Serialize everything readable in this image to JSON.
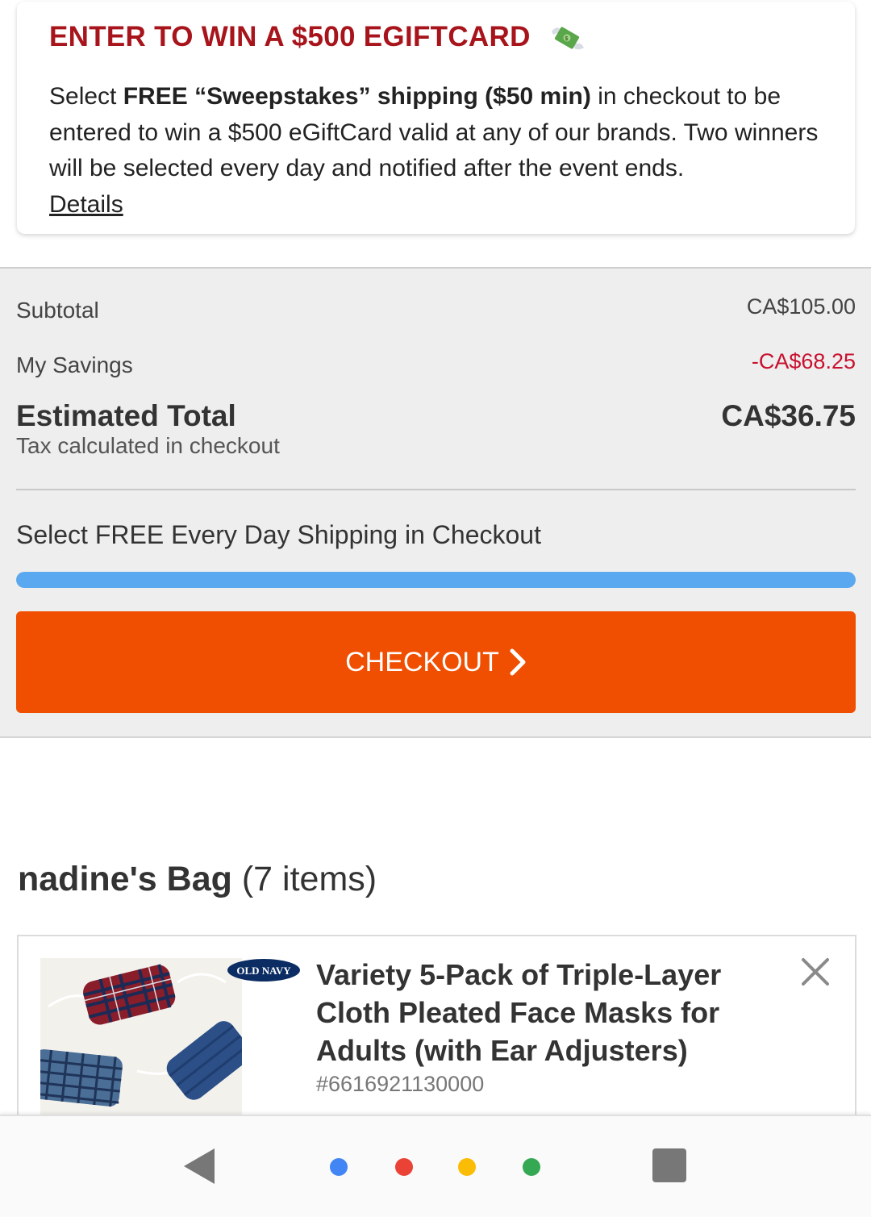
{
  "promo": {
    "title": "ENTER TO WIN A $500 EGIFTCARD",
    "icon": "money-with-wings-icon",
    "body_prefix": "Select ",
    "body_bold": "FREE “Sweepstakes” shipping ($50 min)",
    "body_rest": " in checkout to be entered to win a $500 eGiftCard valid at any of our brands. Two winners will be selected every day and notified after the event ends.",
    "details_link": "Details"
  },
  "summary": {
    "subtotal_label": "Subtotal",
    "subtotal_value": "CA$105.00",
    "savings_label": "My Savings",
    "savings_value": "-CA$68.25",
    "estimated_label": "Estimated Total",
    "estimated_value": "CA$36.75",
    "tax_note": "Tax calculated in checkout",
    "shipping_message": "Select FREE Every Day Shipping in Checkout",
    "shipping_progress_percent": 100,
    "checkout_label": "CHECKOUT"
  },
  "bag": {
    "owner": "nadine's Bag",
    "count": "(7 items)",
    "items": [
      {
        "brand": "OLD NAVY",
        "title": "Variety 5-Pack of Triple-Layer Cloth Pleated Face Masks for Adults (with Ear Adjusters)",
        "sku": "#6616921130000"
      }
    ]
  },
  "colors": {
    "promo_title": "#a8141b",
    "savings": "#c8102e",
    "progress": "#5aa9f0",
    "checkout_button": "#f04e00",
    "brand_badge": "#0b2d63"
  },
  "navbar": {
    "icons": [
      "back-icon",
      "assistant-dot-blue",
      "assistant-dot-red",
      "assistant-dot-yellow",
      "assistant-dot-green",
      "recents-icon"
    ],
    "dot_colors": [
      "#4285f4",
      "#ea4335",
      "#fbbc05",
      "#34a853"
    ]
  }
}
